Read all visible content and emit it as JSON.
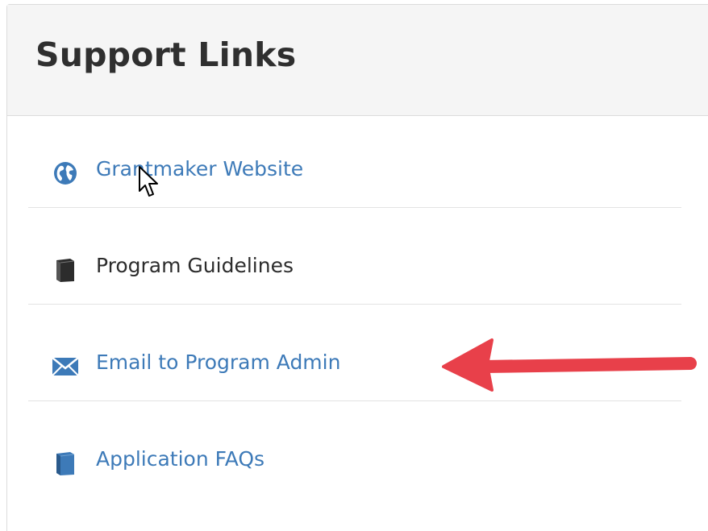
{
  "panel": {
    "title": "Support Links"
  },
  "links": [
    {
      "label": "Grantmaker Website",
      "icon": "globe-icon",
      "color": "#3d7ab8"
    },
    {
      "label": "Program Guidelines",
      "icon": "book-icon",
      "color": "#2c2c2c"
    },
    {
      "label": "Email to Program Admin",
      "icon": "envelope-icon",
      "color": "#3d7ab8"
    },
    {
      "label": "Application FAQs",
      "icon": "book-icon",
      "color": "#3d7ab8"
    }
  ],
  "annotation": {
    "arrow_color": "#e8404a"
  }
}
